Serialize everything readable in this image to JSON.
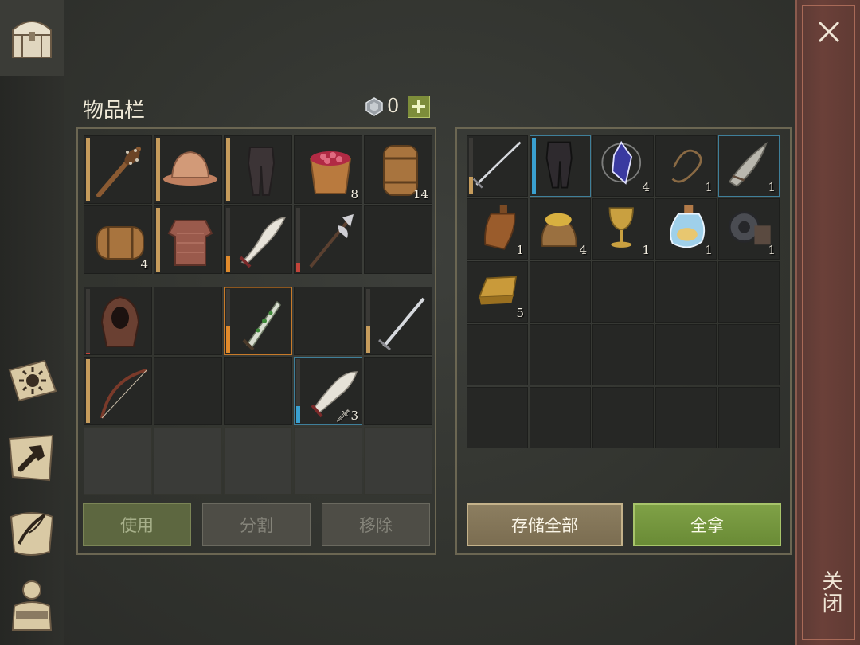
{
  "inventory": {
    "title": "物品栏",
    "currency_count": "0"
  },
  "left_slots": [
    {
      "item": "spiked-club",
      "bar": "fill",
      "bar_pct": 100
    },
    {
      "item": "helmet",
      "bar": "fill",
      "bar_pct": 100
    },
    {
      "item": "leather-pants",
      "bar": "fill",
      "bar_pct": 100
    },
    {
      "item": "berry-bucket",
      "qty": "8"
    },
    {
      "item": "barrel-upright",
      "qty": "14"
    },
    {
      "item": "barrel-side",
      "qty": "4"
    },
    {
      "item": "chainmail",
      "bar": "fill",
      "bar_pct": 100
    },
    {
      "item": "curved-sword",
      "bar": "fill-orange",
      "bar_pct": 28
    },
    {
      "item": "halberd",
      "bar": "fill-red",
      "bar_pct": 18
    },
    {},
    {
      "item": "hood",
      "bar": "fill-red",
      "bar_pct": 5
    },
    {},
    {
      "item": "poison-dagger",
      "bar": "fill-orange",
      "bar_pct": 45,
      "selected": "orange"
    },
    {},
    {
      "item": "longsword",
      "bar": "fill",
      "bar_pct": 45
    },
    {
      "item": "bow",
      "bar": "fill",
      "bar_pct": 100
    },
    {},
    {},
    {
      "item": "scimitar",
      "bar": "fill-blue",
      "bar_pct": 30,
      "selected": "blue",
      "qty": "3",
      "qty_icon": "dagger-small-icon"
    },
    {},
    {
      "dim": true
    },
    {
      "dim": true
    },
    {
      "dim": true
    },
    {
      "dim": true
    },
    {
      "dim": true
    }
  ],
  "right_slots": [
    {
      "item": "sword-long",
      "bar": "fill",
      "bar_pct": 35
    },
    {
      "item": "dark-pants",
      "bar": "fill-blue",
      "bar_pct": 100,
      "selected": "blue"
    },
    {
      "item": "crystal",
      "qty": "4"
    },
    {
      "item": "rope",
      "qty": "1"
    },
    {
      "item": "ornate-blade",
      "qty": "1",
      "selected": "blue"
    },
    {
      "item": "bottle",
      "qty": "1"
    },
    {
      "item": "grain-sack",
      "qty": "4"
    },
    {
      "item": "goblet",
      "qty": "1"
    },
    {
      "item": "potion",
      "qty": "1"
    },
    {
      "item": "iron-gear",
      "qty": "1"
    },
    {
      "item": "gold-ingot",
      "qty": "5"
    },
    {},
    {},
    {},
    {},
    {},
    {},
    {},
    {},
    {},
    {},
    {},
    {},
    {},
    {}
  ],
  "buttons": {
    "use": "使用",
    "split": "分割",
    "remove": "移除",
    "store_all": "存储全部",
    "take_all": "全拿"
  },
  "close_label": "关闭",
  "sidebar": [
    "chest-icon",
    "sun-book-icon",
    "crafting-hammer-icon",
    "scroll-quill-icon",
    "character-icon"
  ]
}
